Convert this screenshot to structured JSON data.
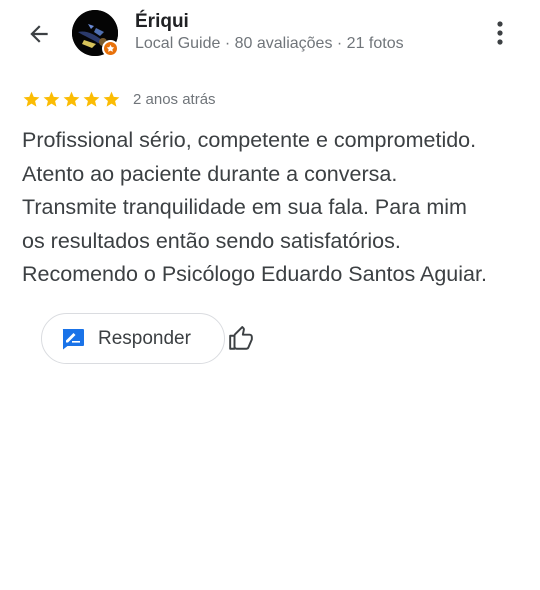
{
  "author": {
    "name": "Ériqui",
    "meta": "Local Guide · 80 avaliações · 21 fotos"
  },
  "review": {
    "rating": 5,
    "max_rating": 5,
    "time_ago": "2 anos atrás",
    "text_lines": [
      "Profissional sério, competente e comprometido.",
      "Atento ao paciente durante a conversa.",
      "Transmite tranquilidade em sua fala. Para mim",
      "os resultados então sendo satisfatórios.",
      "Recomendo o Psicólogo Eduardo Santos Aguiar."
    ]
  },
  "actions": {
    "reply_label": "Responder"
  },
  "icons": {
    "back": "arrow-back-icon",
    "more": "more-vert-icon",
    "badge": "local-guide-star-icon",
    "star": "star-icon",
    "reply": "reply-edit-icon",
    "like": "thumb-up-icon"
  },
  "colors": {
    "star": "#fbbc04",
    "accent_blue": "#1a73e8",
    "local_guide_badge": "#e8710a",
    "text_primary": "#202124",
    "text_secondary": "#70757a",
    "text_body": "#3c4043",
    "border": "#dadce0"
  }
}
